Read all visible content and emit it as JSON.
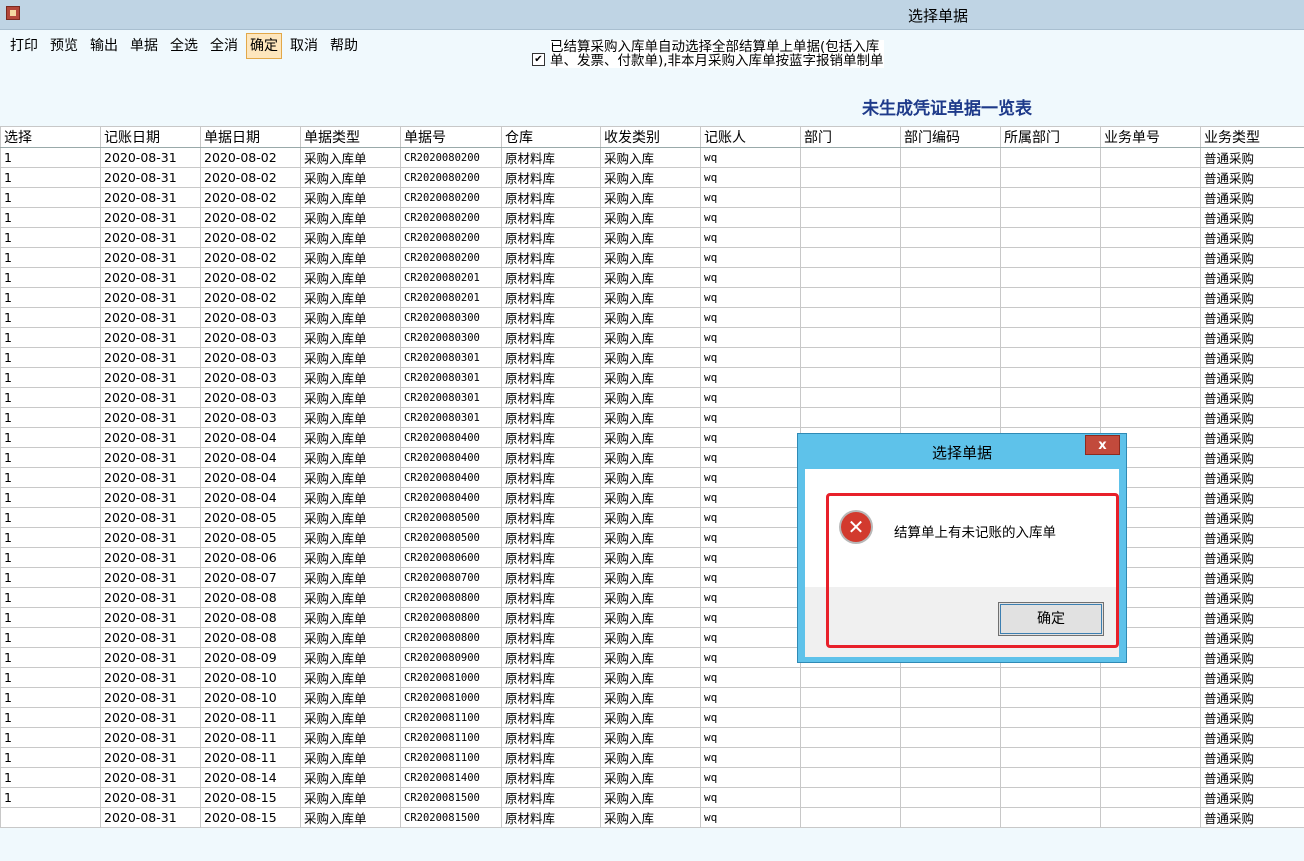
{
  "window": {
    "title": "选择单据"
  },
  "toolbar": {
    "buttons": [
      "打印",
      "预览",
      "输出",
      "单据",
      "全选",
      "全消",
      "确定",
      "取消",
      "帮助"
    ]
  },
  "option": {
    "checked": true,
    "check_glyph": "✔",
    "text_line1": "已结算采购入库单自动选择全部结算单上单据(包括入库",
    "text_line2": "单、发票、付款单),非本月采购入库单按蓝字报销单制单"
  },
  "list_title": "未生成凭证单据一览表",
  "table": {
    "columns": [
      "选择",
      "记账日期",
      "单据日期",
      "单据类型",
      "单据号",
      "仓库",
      "收发类别",
      "记账人",
      "部门",
      "部门编码",
      "所属部门",
      "业务单号",
      "业务类型"
    ],
    "rows": [
      [
        "1",
        "2020-08-31",
        "2020-08-02",
        "采购入库单",
        "CR2020080200",
        "原材料库",
        "采购入库",
        "wq",
        "",
        "",
        "",
        "",
        "普通采购"
      ],
      [
        "1",
        "2020-08-31",
        "2020-08-02",
        "采购入库单",
        "CR2020080200",
        "原材料库",
        "采购入库",
        "wq",
        "",
        "",
        "",
        "",
        "普通采购"
      ],
      [
        "1",
        "2020-08-31",
        "2020-08-02",
        "采购入库单",
        "CR2020080200",
        "原材料库",
        "采购入库",
        "wq",
        "",
        "",
        "",
        "",
        "普通采购"
      ],
      [
        "1",
        "2020-08-31",
        "2020-08-02",
        "采购入库单",
        "CR2020080200",
        "原材料库",
        "采购入库",
        "wq",
        "",
        "",
        "",
        "",
        "普通采购"
      ],
      [
        "1",
        "2020-08-31",
        "2020-08-02",
        "采购入库单",
        "CR2020080200",
        "原材料库",
        "采购入库",
        "wq",
        "",
        "",
        "",
        "",
        "普通采购"
      ],
      [
        "1",
        "2020-08-31",
        "2020-08-02",
        "采购入库单",
        "CR2020080200",
        "原材料库",
        "采购入库",
        "wq",
        "",
        "",
        "",
        "",
        "普通采购"
      ],
      [
        "1",
        "2020-08-31",
        "2020-08-02",
        "采购入库单",
        "CR2020080201",
        "原材料库",
        "采购入库",
        "wq",
        "",
        "",
        "",
        "",
        "普通采购"
      ],
      [
        "1",
        "2020-08-31",
        "2020-08-02",
        "采购入库单",
        "CR2020080201",
        "原材料库",
        "采购入库",
        "wq",
        "",
        "",
        "",
        "",
        "普通采购"
      ],
      [
        "1",
        "2020-08-31",
        "2020-08-03",
        "采购入库单",
        "CR2020080300",
        "原材料库",
        "采购入库",
        "wq",
        "",
        "",
        "",
        "",
        "普通采购"
      ],
      [
        "1",
        "2020-08-31",
        "2020-08-03",
        "采购入库单",
        "CR2020080300",
        "原材料库",
        "采购入库",
        "wq",
        "",
        "",
        "",
        "",
        "普通采购"
      ],
      [
        "1",
        "2020-08-31",
        "2020-08-03",
        "采购入库单",
        "CR2020080301",
        "原材料库",
        "采购入库",
        "wq",
        "",
        "",
        "",
        "",
        "普通采购"
      ],
      [
        "1",
        "2020-08-31",
        "2020-08-03",
        "采购入库单",
        "CR2020080301",
        "原材料库",
        "采购入库",
        "wq",
        "",
        "",
        "",
        "",
        "普通采购"
      ],
      [
        "1",
        "2020-08-31",
        "2020-08-03",
        "采购入库单",
        "CR2020080301",
        "原材料库",
        "采购入库",
        "wq",
        "",
        "",
        "",
        "",
        "普通采购"
      ],
      [
        "1",
        "2020-08-31",
        "2020-08-03",
        "采购入库单",
        "CR2020080301",
        "原材料库",
        "采购入库",
        "wq",
        "",
        "",
        "",
        "",
        "普通采购"
      ],
      [
        "1",
        "2020-08-31",
        "2020-08-04",
        "采购入库单",
        "CR2020080400",
        "原材料库",
        "采购入库",
        "wq",
        "",
        "",
        "",
        "",
        "普通采购"
      ],
      [
        "1",
        "2020-08-31",
        "2020-08-04",
        "采购入库单",
        "CR2020080400",
        "原材料库",
        "采购入库",
        "wq",
        "",
        "",
        "",
        "",
        "普通采购"
      ],
      [
        "1",
        "2020-08-31",
        "2020-08-04",
        "采购入库单",
        "CR2020080400",
        "原材料库",
        "采购入库",
        "wq",
        "",
        "",
        "",
        "",
        "普通采购"
      ],
      [
        "1",
        "2020-08-31",
        "2020-08-04",
        "采购入库单",
        "CR2020080400",
        "原材料库",
        "采购入库",
        "wq",
        "",
        "",
        "",
        "",
        "普通采购"
      ],
      [
        "1",
        "2020-08-31",
        "2020-08-05",
        "采购入库单",
        "CR2020080500",
        "原材料库",
        "采购入库",
        "wq",
        "",
        "",
        "",
        "",
        "普通采购"
      ],
      [
        "1",
        "2020-08-31",
        "2020-08-05",
        "采购入库单",
        "CR2020080500",
        "原材料库",
        "采购入库",
        "wq",
        "",
        "",
        "",
        "",
        "普通采购"
      ],
      [
        "1",
        "2020-08-31",
        "2020-08-06",
        "采购入库单",
        "CR2020080600",
        "原材料库",
        "采购入库",
        "wq",
        "",
        "",
        "",
        "",
        "普通采购"
      ],
      [
        "1",
        "2020-08-31",
        "2020-08-07",
        "采购入库单",
        "CR2020080700",
        "原材料库",
        "采购入库",
        "wq",
        "",
        "",
        "",
        "",
        "普通采购"
      ],
      [
        "1",
        "2020-08-31",
        "2020-08-08",
        "采购入库单",
        "CR2020080800",
        "原材料库",
        "采购入库",
        "wq",
        "",
        "",
        "",
        "",
        "普通采购"
      ],
      [
        "1",
        "2020-08-31",
        "2020-08-08",
        "采购入库单",
        "CR2020080800",
        "原材料库",
        "采购入库",
        "wq",
        "",
        "",
        "",
        "",
        "普通采购"
      ],
      [
        "1",
        "2020-08-31",
        "2020-08-08",
        "采购入库单",
        "CR2020080800",
        "原材料库",
        "采购入库",
        "wq",
        "",
        "",
        "",
        "",
        "普通采购"
      ],
      [
        "1",
        "2020-08-31",
        "2020-08-09",
        "采购入库单",
        "CR2020080900",
        "原材料库",
        "采购入库",
        "wq",
        "",
        "",
        "",
        "",
        "普通采购"
      ],
      [
        "1",
        "2020-08-31",
        "2020-08-10",
        "采购入库单",
        "CR2020081000",
        "原材料库",
        "采购入库",
        "wq",
        "",
        "",
        "",
        "",
        "普通采购"
      ],
      [
        "1",
        "2020-08-31",
        "2020-08-10",
        "采购入库单",
        "CR2020081000",
        "原材料库",
        "采购入库",
        "wq",
        "",
        "",
        "",
        "",
        "普通采购"
      ],
      [
        "1",
        "2020-08-31",
        "2020-08-11",
        "采购入库单",
        "CR2020081100",
        "原材料库",
        "采购入库",
        "wq",
        "",
        "",
        "",
        "",
        "普通采购"
      ],
      [
        "1",
        "2020-08-31",
        "2020-08-11",
        "采购入库单",
        "CR2020081100",
        "原材料库",
        "采购入库",
        "wq",
        "",
        "",
        "",
        "",
        "普通采购"
      ],
      [
        "1",
        "2020-08-31",
        "2020-08-11",
        "采购入库单",
        "CR2020081100",
        "原材料库",
        "采购入库",
        "wq",
        "",
        "",
        "",
        "",
        "普通采购"
      ],
      [
        "1",
        "2020-08-31",
        "2020-08-14",
        "采购入库单",
        "CR2020081400",
        "原材料库",
        "采购入库",
        "wq",
        "",
        "",
        "",
        "",
        "普通采购"
      ],
      [
        "1",
        "2020-08-31",
        "2020-08-15",
        "采购入库单",
        "CR2020081500",
        "原材料库",
        "采购入库",
        "wq",
        "",
        "",
        "",
        "",
        "普通采购"
      ],
      [
        "",
        "2020-08-31",
        "2020-08-15",
        "采购入库单",
        "CR2020081500",
        "原材料库",
        "采购入库",
        "wq",
        "",
        "",
        "",
        "",
        "普通采购"
      ]
    ]
  },
  "dialog": {
    "title": "选择单据",
    "close_glyph": "x",
    "error_glyph": "✕",
    "message": "结算单上有未记账的入库单",
    "ok_label": "确定"
  },
  "colors": {
    "titlebar": "#bfd4e4",
    "background": "#f0f9fd",
    "list_title": "#1e3a8a",
    "dialog_frame": "#5ec2ea",
    "error_red": "#d23a2e",
    "highlight_red": "#e8202a",
    "active_button": "#fde6bd"
  },
  "icons": {
    "app": "app-logo-icon",
    "checkbox": "checkmark-icon",
    "error": "error-x-icon",
    "close": "close-icon"
  }
}
